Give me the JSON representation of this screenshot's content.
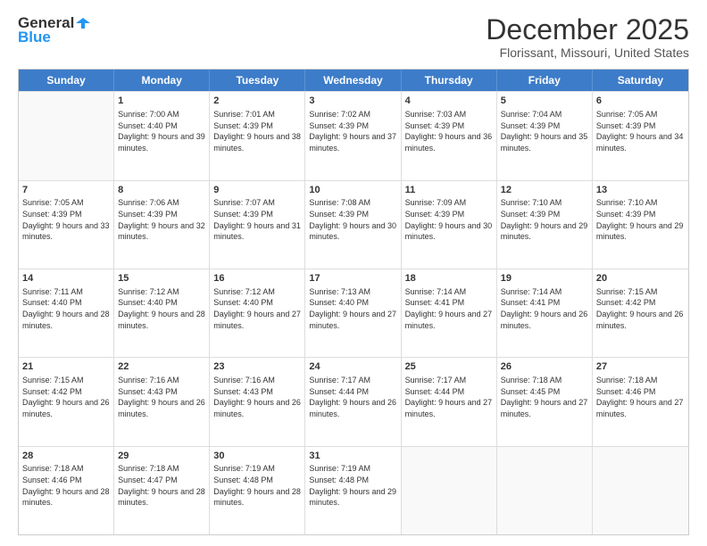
{
  "logo": {
    "line1": "General",
    "line2": "Blue"
  },
  "title": "December 2025",
  "location": "Florissant, Missouri, United States",
  "days": [
    "Sunday",
    "Monday",
    "Tuesday",
    "Wednesday",
    "Thursday",
    "Friday",
    "Saturday"
  ],
  "weeks": [
    [
      {
        "day": "",
        "sunrise": "",
        "sunset": "",
        "daylight": ""
      },
      {
        "day": "1",
        "sunrise": "Sunrise: 7:00 AM",
        "sunset": "Sunset: 4:40 PM",
        "daylight": "Daylight: 9 hours and 39 minutes."
      },
      {
        "day": "2",
        "sunrise": "Sunrise: 7:01 AM",
        "sunset": "Sunset: 4:39 PM",
        "daylight": "Daylight: 9 hours and 38 minutes."
      },
      {
        "day": "3",
        "sunrise": "Sunrise: 7:02 AM",
        "sunset": "Sunset: 4:39 PM",
        "daylight": "Daylight: 9 hours and 37 minutes."
      },
      {
        "day": "4",
        "sunrise": "Sunrise: 7:03 AM",
        "sunset": "Sunset: 4:39 PM",
        "daylight": "Daylight: 9 hours and 36 minutes."
      },
      {
        "day": "5",
        "sunrise": "Sunrise: 7:04 AM",
        "sunset": "Sunset: 4:39 PM",
        "daylight": "Daylight: 9 hours and 35 minutes."
      },
      {
        "day": "6",
        "sunrise": "Sunrise: 7:05 AM",
        "sunset": "Sunset: 4:39 PM",
        "daylight": "Daylight: 9 hours and 34 minutes."
      }
    ],
    [
      {
        "day": "7",
        "sunrise": "Sunrise: 7:05 AM",
        "sunset": "Sunset: 4:39 PM",
        "daylight": "Daylight: 9 hours and 33 minutes."
      },
      {
        "day": "8",
        "sunrise": "Sunrise: 7:06 AM",
        "sunset": "Sunset: 4:39 PM",
        "daylight": "Daylight: 9 hours and 32 minutes."
      },
      {
        "day": "9",
        "sunrise": "Sunrise: 7:07 AM",
        "sunset": "Sunset: 4:39 PM",
        "daylight": "Daylight: 9 hours and 31 minutes."
      },
      {
        "day": "10",
        "sunrise": "Sunrise: 7:08 AM",
        "sunset": "Sunset: 4:39 PM",
        "daylight": "Daylight: 9 hours and 30 minutes."
      },
      {
        "day": "11",
        "sunrise": "Sunrise: 7:09 AM",
        "sunset": "Sunset: 4:39 PM",
        "daylight": "Daylight: 9 hours and 30 minutes."
      },
      {
        "day": "12",
        "sunrise": "Sunrise: 7:10 AM",
        "sunset": "Sunset: 4:39 PM",
        "daylight": "Daylight: 9 hours and 29 minutes."
      },
      {
        "day": "13",
        "sunrise": "Sunrise: 7:10 AM",
        "sunset": "Sunset: 4:39 PM",
        "daylight": "Daylight: 9 hours and 29 minutes."
      }
    ],
    [
      {
        "day": "14",
        "sunrise": "Sunrise: 7:11 AM",
        "sunset": "Sunset: 4:40 PM",
        "daylight": "Daylight: 9 hours and 28 minutes."
      },
      {
        "day": "15",
        "sunrise": "Sunrise: 7:12 AM",
        "sunset": "Sunset: 4:40 PM",
        "daylight": "Daylight: 9 hours and 28 minutes."
      },
      {
        "day": "16",
        "sunrise": "Sunrise: 7:12 AM",
        "sunset": "Sunset: 4:40 PM",
        "daylight": "Daylight: 9 hours and 27 minutes."
      },
      {
        "day": "17",
        "sunrise": "Sunrise: 7:13 AM",
        "sunset": "Sunset: 4:40 PM",
        "daylight": "Daylight: 9 hours and 27 minutes."
      },
      {
        "day": "18",
        "sunrise": "Sunrise: 7:14 AM",
        "sunset": "Sunset: 4:41 PM",
        "daylight": "Daylight: 9 hours and 27 minutes."
      },
      {
        "day": "19",
        "sunrise": "Sunrise: 7:14 AM",
        "sunset": "Sunset: 4:41 PM",
        "daylight": "Daylight: 9 hours and 26 minutes."
      },
      {
        "day": "20",
        "sunrise": "Sunrise: 7:15 AM",
        "sunset": "Sunset: 4:42 PM",
        "daylight": "Daylight: 9 hours and 26 minutes."
      }
    ],
    [
      {
        "day": "21",
        "sunrise": "Sunrise: 7:15 AM",
        "sunset": "Sunset: 4:42 PM",
        "daylight": "Daylight: 9 hours and 26 minutes."
      },
      {
        "day": "22",
        "sunrise": "Sunrise: 7:16 AM",
        "sunset": "Sunset: 4:43 PM",
        "daylight": "Daylight: 9 hours and 26 minutes."
      },
      {
        "day": "23",
        "sunrise": "Sunrise: 7:16 AM",
        "sunset": "Sunset: 4:43 PM",
        "daylight": "Daylight: 9 hours and 26 minutes."
      },
      {
        "day": "24",
        "sunrise": "Sunrise: 7:17 AM",
        "sunset": "Sunset: 4:44 PM",
        "daylight": "Daylight: 9 hours and 26 minutes."
      },
      {
        "day": "25",
        "sunrise": "Sunrise: 7:17 AM",
        "sunset": "Sunset: 4:44 PM",
        "daylight": "Daylight: 9 hours and 27 minutes."
      },
      {
        "day": "26",
        "sunrise": "Sunrise: 7:18 AM",
        "sunset": "Sunset: 4:45 PM",
        "daylight": "Daylight: 9 hours and 27 minutes."
      },
      {
        "day": "27",
        "sunrise": "Sunrise: 7:18 AM",
        "sunset": "Sunset: 4:46 PM",
        "daylight": "Daylight: 9 hours and 27 minutes."
      }
    ],
    [
      {
        "day": "28",
        "sunrise": "Sunrise: 7:18 AM",
        "sunset": "Sunset: 4:46 PM",
        "daylight": "Daylight: 9 hours and 28 minutes."
      },
      {
        "day": "29",
        "sunrise": "Sunrise: 7:18 AM",
        "sunset": "Sunset: 4:47 PM",
        "daylight": "Daylight: 9 hours and 28 minutes."
      },
      {
        "day": "30",
        "sunrise": "Sunrise: 7:19 AM",
        "sunset": "Sunset: 4:48 PM",
        "daylight": "Daylight: 9 hours and 28 minutes."
      },
      {
        "day": "31",
        "sunrise": "Sunrise: 7:19 AM",
        "sunset": "Sunset: 4:48 PM",
        "daylight": "Daylight: 9 hours and 29 minutes."
      },
      {
        "day": "",
        "sunrise": "",
        "sunset": "",
        "daylight": ""
      },
      {
        "day": "",
        "sunrise": "",
        "sunset": "",
        "daylight": ""
      },
      {
        "day": "",
        "sunrise": "",
        "sunset": "",
        "daylight": ""
      }
    ]
  ]
}
